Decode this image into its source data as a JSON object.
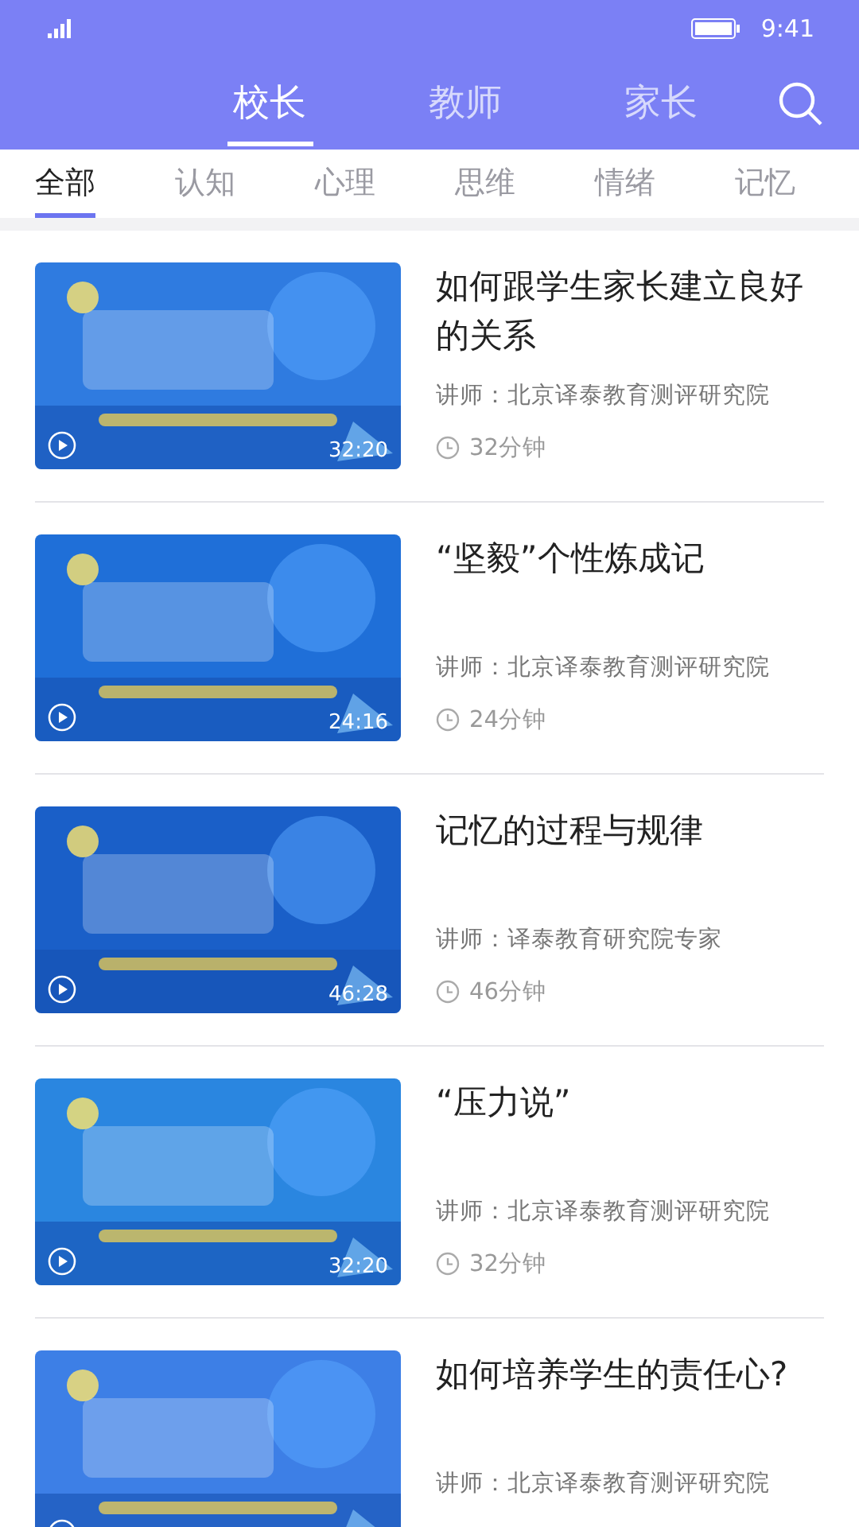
{
  "status_bar": {
    "time": "9:41"
  },
  "top_tabs": [
    {
      "label": "校长",
      "selected": true
    },
    {
      "label": "教师",
      "selected": false
    },
    {
      "label": "家长",
      "selected": false
    }
  ],
  "categories": [
    {
      "label": "全部",
      "selected": true
    },
    {
      "label": "认知",
      "selected": false
    },
    {
      "label": "心理",
      "selected": false
    },
    {
      "label": "思维",
      "selected": false
    },
    {
      "label": "情绪",
      "selected": false
    },
    {
      "label": "记忆",
      "selected": false
    }
  ],
  "courses": [
    {
      "title": "如何跟学生家长建立良好的关系",
      "lecturer": "讲师：北京译泰教育测评研究院",
      "duration": "32分钟",
      "length": "32:20"
    },
    {
      "title": "“坚毅”个性炼成记",
      "lecturer": "讲师：北京译泰教育测评研究院",
      "duration": "24分钟",
      "length": "24:16"
    },
    {
      "title": "记忆的过程与规律",
      "lecturer": "讲师：译泰教育研究院专家",
      "duration": "46分钟",
      "length": "46:28"
    },
    {
      "title": "“压力说”",
      "lecturer": "讲师：北京译泰教育测评研究院",
      "duration": "32分钟",
      "length": "32:20"
    },
    {
      "title": "如何培养学生的责任心?",
      "lecturer": "讲师：北京译泰教育测评研究院"
    }
  ]
}
